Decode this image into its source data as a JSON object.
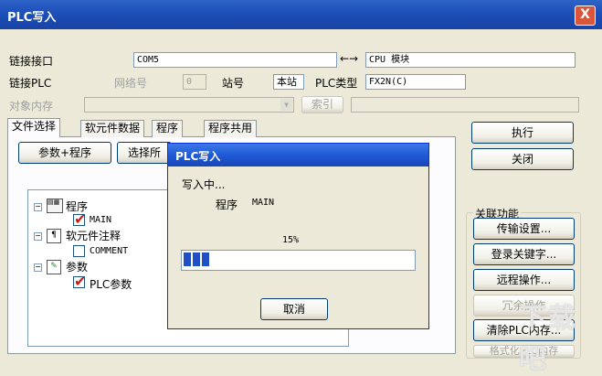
{
  "window": {
    "title": "PLC写入",
    "close": "X"
  },
  "connection": {
    "interface_label": "链接接口",
    "interface_value": "COM5",
    "arrow": "←→",
    "cpu_value": "CPU 模块",
    "plc_label": "链接PLC",
    "network_label": "网络号",
    "network_value": "0",
    "station_label": "站号",
    "station_value": "本站",
    "plc_type_label": "PLC类型",
    "plc_type_value": "FX2N(C)",
    "target_memory_label": "对象内存",
    "index_button": "索引"
  },
  "tabs": [
    "文件选择",
    "软元件数据",
    "程序",
    "程序共用"
  ],
  "file_select": {
    "param_program_button": "参数+程序",
    "select_all_button": "选择所"
  },
  "tree": {
    "program_label": "程序",
    "main_label": "MAIN",
    "device_comment_label": "软元件注释",
    "comment_label": "COMMENT",
    "parameter_label": "参数",
    "plc_param_label": "PLC参数"
  },
  "right_buttons": {
    "execute": "执行",
    "close": "关闭"
  },
  "related": {
    "title": "关联功能",
    "transfer_setup": "传输设置...",
    "register_keyword": "登录关键字...",
    "remote_op": "远程操作...",
    "redundant_op": "冗余操作",
    "clear_memory": "清除PLC内存...",
    "partial": "格式化PLC内存"
  },
  "dialog": {
    "title": "PLC写入",
    "writing": "写入中...",
    "program_label": "程序",
    "program_name": "MAIN",
    "percent_text": "15%",
    "progress": 0.15,
    "cancel": "取消"
  },
  "watermark": "下载吧"
}
